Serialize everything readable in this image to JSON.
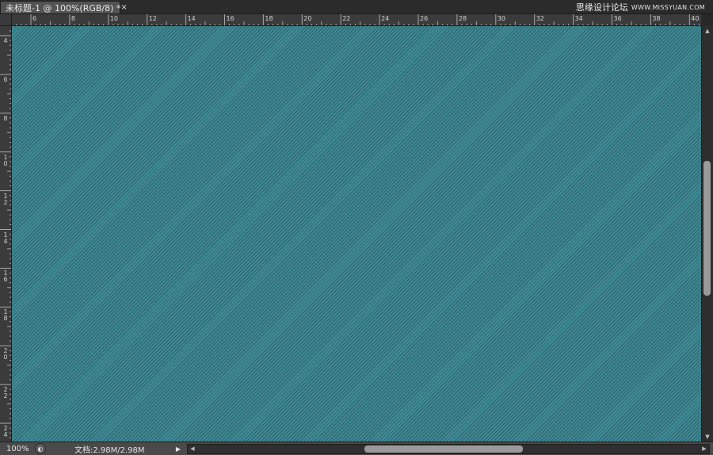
{
  "document_tab": {
    "title": "未标题-1 @ 100%(RGB/8) *",
    "close_symbol": "×"
  },
  "watermark": {
    "text": "思缘设计论坛",
    "site": "WWW.MISSYUAN.COM"
  },
  "ruler_horizontal": {
    "labels": [
      "6",
      "8",
      "10",
      "12",
      "14",
      "16",
      "18",
      "20",
      "22",
      "24",
      "26",
      "28",
      "30",
      "32",
      "34",
      "36",
      "38",
      "40"
    ]
  },
  "ruler_vertical": {
    "labels": [
      "4",
      "6",
      "8",
      "1 0",
      "1 2",
      "1 4",
      "1 6",
      "1 8",
      "2 0",
      "2 2",
      "2 4"
    ]
  },
  "statusbar": {
    "zoom": "100%",
    "doc_size": "文档:2.98M/2.98M",
    "menu_arrow": "▶"
  },
  "scroll": {
    "up": "▲",
    "down": "▼",
    "left": "◀",
    "right": "▶"
  },
  "colors": {
    "canvas_fill": "#3e8b96",
    "stripe": "#1e373e"
  }
}
